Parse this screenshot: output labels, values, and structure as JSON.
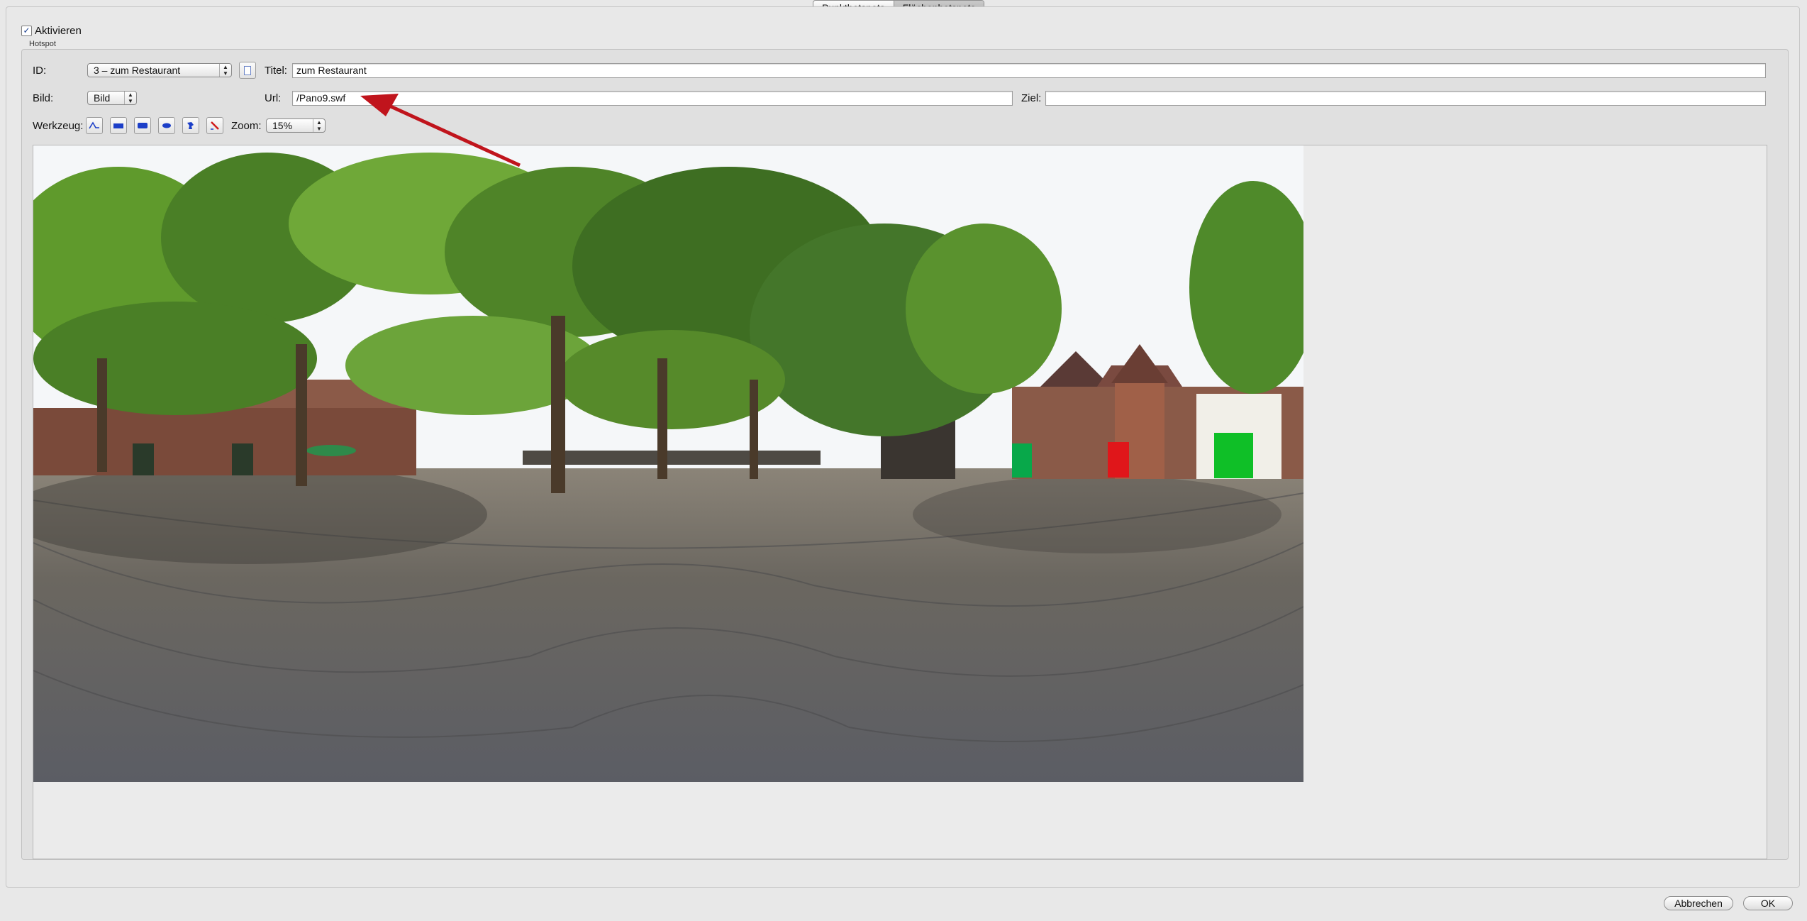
{
  "tabs": {
    "point": "Punkthotspots",
    "area": "Flächenhotspots",
    "selected": "area"
  },
  "activate": {
    "label": "Aktivieren",
    "checked": true
  },
  "group_label": "Hotspot",
  "form": {
    "id_label": "ID:",
    "id_value": "3 – zum Restaurant",
    "title_label": "Titel:",
    "title_value": "zum Restaurant",
    "image_label": "Bild:",
    "image_value": "Bild",
    "url_label": "Url:",
    "url_value": "/Pano9.swf",
    "target_label": "Ziel:",
    "target_value": "",
    "tool_label": "Werkzeug:",
    "zoom_label": "Zoom:",
    "zoom_value": "15%"
  },
  "tools": [
    "polygon-tool-icon",
    "rectangle-tool-icon",
    "rounded-rectangle-tool-icon",
    "ellipse-tool-icon",
    "freeform-tool-icon",
    "eraser-tool-icon"
  ],
  "annotation": {
    "type": "arrow",
    "color": "#c0141c",
    "points_to": "url-field"
  },
  "footer": {
    "cancel": "Abbrechen",
    "ok": "OK"
  }
}
